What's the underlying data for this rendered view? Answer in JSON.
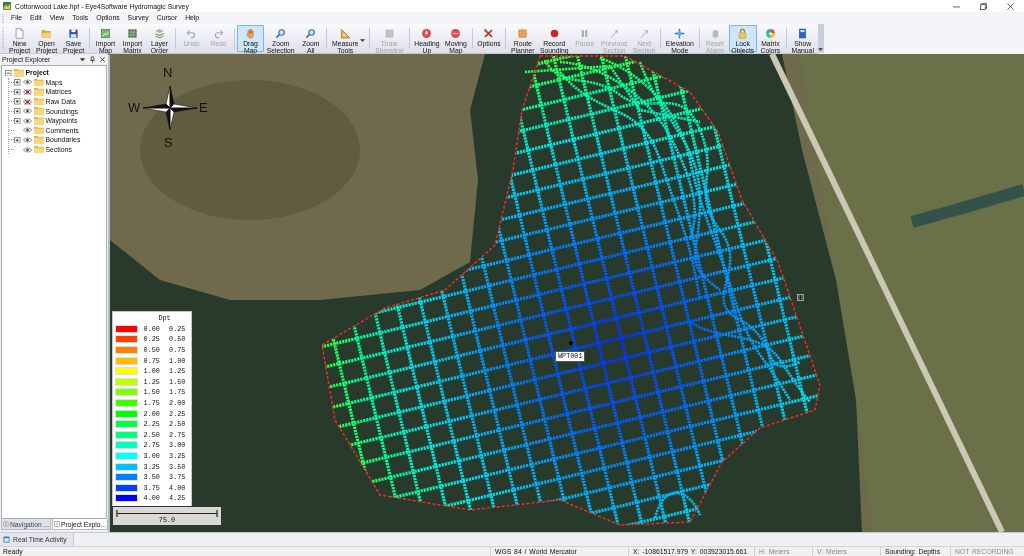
{
  "window": {
    "title": "Cottonwood Lake.hpf - Eye4Software Hydromagic Survey"
  },
  "menu": [
    "File",
    "Edit",
    "View",
    "Tools",
    "Options",
    "Survey",
    "Cursor",
    "Help"
  ],
  "toolbar": {
    "groups": [
      [
        {
          "label": "New Project",
          "selected": false,
          "disabled": false
        },
        {
          "label": "Open Project",
          "selected": false,
          "disabled": false
        },
        {
          "label": "Save Project",
          "selected": false,
          "disabled": false
        }
      ],
      [
        {
          "label": "Import Map",
          "selected": false,
          "disabled": false
        },
        {
          "label": "Import Matrix",
          "selected": false,
          "disabled": false
        },
        {
          "label": "Layer Order",
          "selected": false,
          "disabled": false
        }
      ],
      [
        {
          "label": "Undo",
          "selected": false,
          "disabled": true
        },
        {
          "label": "Redo",
          "selected": false,
          "disabled": true
        }
      ],
      [
        {
          "label": "Drag Map",
          "selected": true,
          "disabled": false
        },
        {
          "label": "Zoom Selection",
          "selected": false,
          "disabled": false
        },
        {
          "label": "Zoom All",
          "selected": false,
          "disabled": false
        }
      ],
      [
        {
          "label": "Measure Tools",
          "selected": false,
          "disabled": false,
          "dropdown": true
        }
      ],
      [
        {
          "label": "Draw Shoreline",
          "selected": false,
          "disabled": true
        }
      ],
      [
        {
          "label": "Heading Up",
          "selected": false,
          "disabled": false
        },
        {
          "label": "Moving Map",
          "selected": false,
          "disabled": false
        }
      ],
      [
        {
          "label": "Options",
          "selected": false,
          "disabled": false
        }
      ],
      [
        {
          "label": "Route Planner",
          "selected": false,
          "disabled": false
        },
        {
          "label": "Record Sounding",
          "selected": false,
          "disabled": false
        },
        {
          "label": "Pause",
          "selected": false,
          "disabled": true
        },
        {
          "label": "Previous Section",
          "selected": false,
          "disabled": true
        },
        {
          "label": "Next Section",
          "selected": false,
          "disabled": true
        }
      ],
      [
        {
          "label": "Elevation Mode",
          "selected": false,
          "disabled": false
        }
      ],
      [
        {
          "label": "Reset Alarm",
          "selected": false,
          "disabled": true
        },
        {
          "label": "Lock Objects",
          "selected": true,
          "disabled": false
        },
        {
          "label": "Matrix Colors",
          "selected": false,
          "disabled": false
        }
      ],
      [
        {
          "label": "Show Manual",
          "selected": false,
          "disabled": false
        }
      ]
    ]
  },
  "project_explorer": {
    "title": "Project Explorer",
    "tree": {
      "label": "Project",
      "expanded": true,
      "children": [
        {
          "label": "Maps",
          "visible": true,
          "expandable": true
        },
        {
          "label": "Matrices",
          "visible": false,
          "expandable": true
        },
        {
          "label": "Raw Data",
          "visible": false,
          "expandable": true
        },
        {
          "label": "Soundings",
          "visible": true,
          "expandable": true
        },
        {
          "label": "Waypoints",
          "visible": true,
          "expandable": true
        },
        {
          "label": "Comments",
          "visible": true,
          "expandable": false
        },
        {
          "label": "Boundaries",
          "visible": true,
          "expandable": true
        },
        {
          "label": "Sections",
          "visible": true,
          "expandable": false
        }
      ]
    },
    "tabs": [
      {
        "label": "Navigation ...",
        "selected": false
      },
      {
        "label": "Project Explo...",
        "selected": true
      }
    ]
  },
  "map": {
    "compass": {
      "north": "N",
      "east": "E",
      "south": "S",
      "west": "W"
    },
    "waypoint": {
      "label": "WPT001"
    },
    "legend": {
      "title": "Dpt",
      "rows": [
        {
          "color": "#ff0000",
          "from": "0.00",
          "to": "0.25"
        },
        {
          "color": "#ff4000",
          "from": "0.25",
          "to": "0.50"
        },
        {
          "color": "#ff8000",
          "from": "0.50",
          "to": "0.75"
        },
        {
          "color": "#ffbf00",
          "from": "0.75",
          "to": "1.00"
        },
        {
          "color": "#ffff00",
          "from": "1.00",
          "to": "1.25"
        },
        {
          "color": "#bfff00",
          "from": "1.25",
          "to": "1.50"
        },
        {
          "color": "#80ff00",
          "from": "1.50",
          "to": "1.75"
        },
        {
          "color": "#40ff00",
          "from": "1.75",
          "to": "2.00"
        },
        {
          "color": "#00ff00",
          "from": "2.00",
          "to": "2.25"
        },
        {
          "color": "#00ff40",
          "from": "2.25",
          "to": "2.50"
        },
        {
          "color": "#00ff80",
          "from": "2.50",
          "to": "2.75"
        },
        {
          "color": "#00ffbf",
          "from": "2.75",
          "to": "3.00"
        },
        {
          "color": "#00ffff",
          "from": "3.00",
          "to": "3.25"
        },
        {
          "color": "#00bfff",
          "from": "3.25",
          "to": "3.50"
        },
        {
          "color": "#0080ff",
          "from": "3.50",
          "to": "3.75"
        },
        {
          "color": "#0040ff",
          "from": "3.75",
          "to": "4.00"
        },
        {
          "color": "#0000ff",
          "from": "4.00",
          "to": "4.25"
        }
      ]
    },
    "scale_bar": {
      "label": "75.0"
    }
  },
  "activity_tab": {
    "label": "Real Time Activity"
  },
  "status_bar": [
    {
      "text": "Ready",
      "disabled": false
    },
    {
      "text": "WGS 84 / World Mercator",
      "disabled": false
    },
    {
      "text": "X: -10861517.979 Y: 003923015.661",
      "disabled": false
    },
    {
      "text": "H: Meters",
      "disabled": true
    },
    {
      "text": "V: Meters",
      "disabled": true
    },
    {
      "text": "Sounding: Depths",
      "disabled": false
    },
    {
      "text": "NOT RECORDING",
      "disabled": true
    }
  ]
}
